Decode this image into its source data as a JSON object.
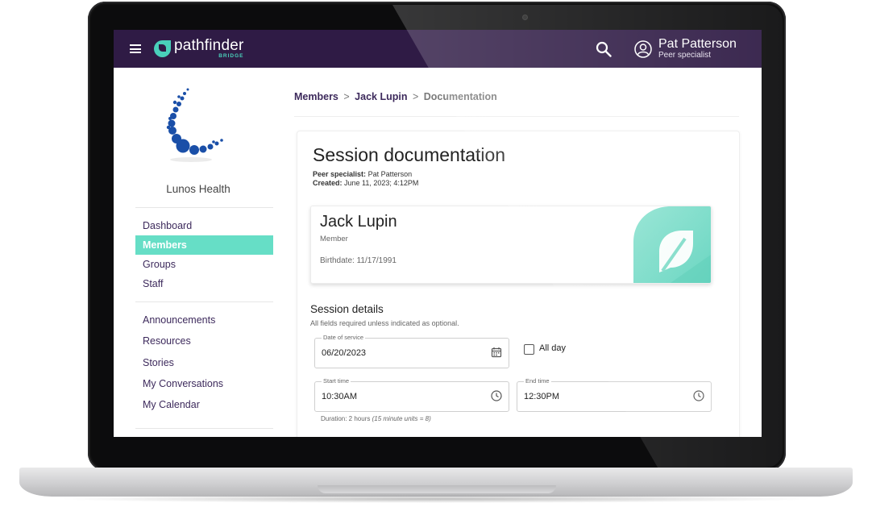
{
  "header": {
    "brand": "pathfinder",
    "brand_sub": "BRIDGE",
    "user_name": "Pat Patterson",
    "user_role": "Peer specialist"
  },
  "sidebar": {
    "org_name": "Lunos Health",
    "primary_items": [
      {
        "label": "Dashboard",
        "active": false
      },
      {
        "label": "Members",
        "active": true
      },
      {
        "label": "Groups",
        "active": false
      },
      {
        "label": "Staff",
        "active": false
      }
    ],
    "secondary_items": [
      {
        "label": "Announcements"
      },
      {
        "label": "Resources"
      },
      {
        "label": "Stories"
      },
      {
        "label": "My Conversations"
      },
      {
        "label": "My Calendar"
      }
    ]
  },
  "breadcrumb": {
    "items": [
      "Members",
      "Jack Lupin"
    ],
    "separator": ">",
    "current": "Documentation"
  },
  "doc": {
    "title": "Session documentation",
    "specialist_label": "Peer specialist:",
    "specialist_value": "Pat Patterson",
    "created_label": "Created:",
    "created_value": "June 11, 2023; 4:12PM"
  },
  "member": {
    "name": "Jack Lupin",
    "role": "Member",
    "birthdate": "Birthdate: 11/17/1991"
  },
  "session": {
    "title": "Session details",
    "subtitle": "All fields required unless indicated as optional.",
    "date_label": "Date of service",
    "date_value": "06/20/2023",
    "all_day_label": "All day",
    "all_day_checked": false,
    "start_label": "Start time",
    "start_value": "10:30AM",
    "end_label": "End time",
    "end_value": "12:30PM",
    "duration_text": "Duration: 2 hours",
    "duration_units": "(15 minute units = 8)"
  },
  "icons": {
    "menu": "hamburger-icon",
    "search": "search-icon",
    "avatar": "account-circle-icon",
    "calendar": "calendar-icon",
    "clock": "clock-icon"
  },
  "colors": {
    "topbar": "#2f1b45",
    "accent": "#66dec6",
    "nav_text": "#3d2a5c",
    "org_blue": "#1a4fa8"
  }
}
